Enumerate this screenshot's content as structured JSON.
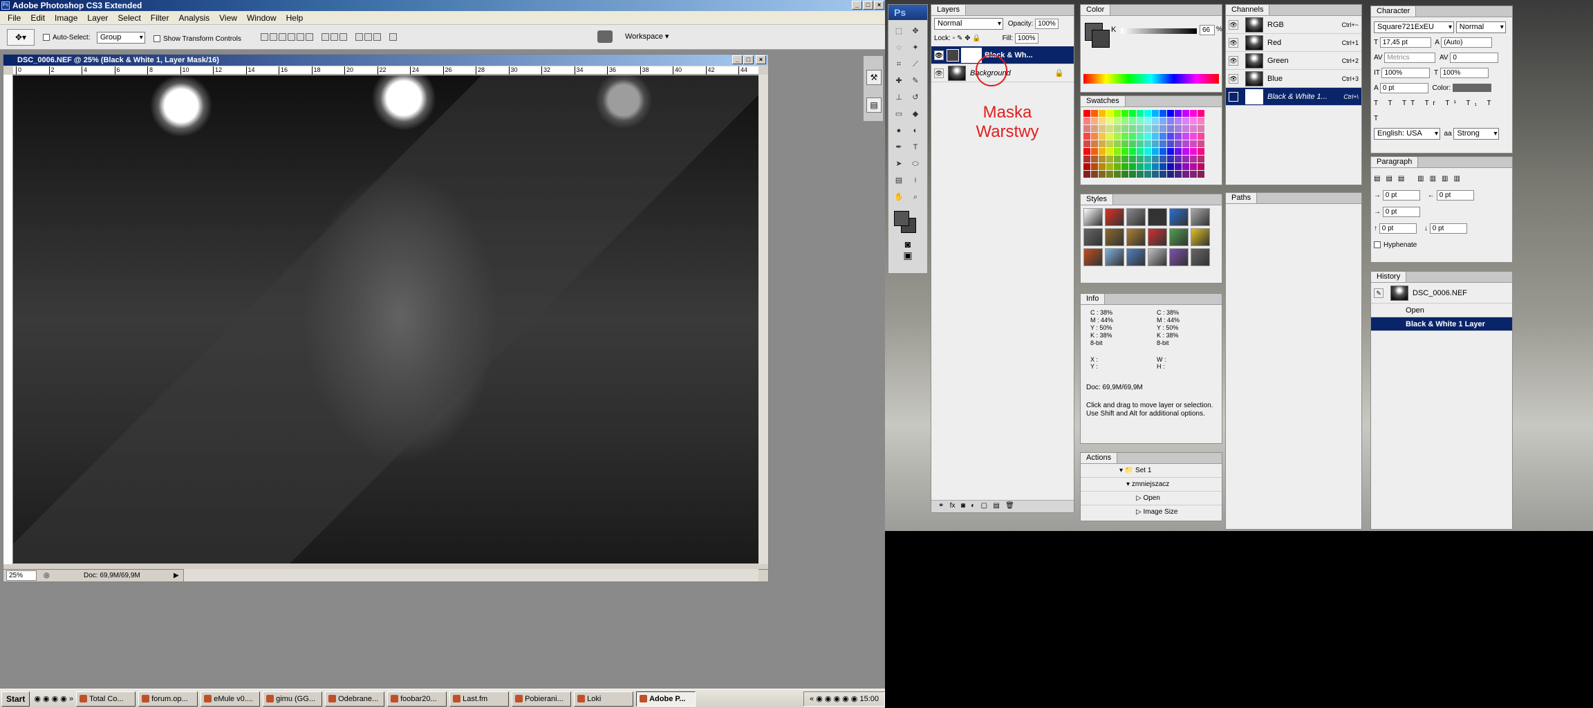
{
  "app": {
    "title": "Adobe Photoshop CS3 Extended"
  },
  "menu": [
    "File",
    "Edit",
    "Image",
    "Layer",
    "Select",
    "Filter",
    "Analysis",
    "View",
    "Window",
    "Help"
  ],
  "options": {
    "auto_select_label": "Auto-Select:",
    "auto_select_value": "Group",
    "transform_label": "Show Transform Controls",
    "workspace_label": "Workspace ▾"
  },
  "document": {
    "title": "DSC_0006.NEF @ 25% (Black & White 1, Layer Mask/16)",
    "zoom": "25%",
    "doc_size": "Doc: 69,9M/69,9M",
    "ruler_ticks": [
      "0",
      "2",
      "4",
      "6",
      "8",
      "10",
      "12",
      "14",
      "16",
      "18",
      "20",
      "22",
      "24",
      "26",
      "28",
      "30",
      "32",
      "34",
      "36",
      "38",
      "40",
      "42",
      "44"
    ]
  },
  "taskbar": {
    "start": "Start",
    "tasks": [
      "Total Co...",
      "forum.op...",
      "eMule v0....",
      "gimu (GG...",
      "Odebrane...",
      "foobar20...",
      "Last.fm",
      "Pobierani...",
      "Loki",
      "Adobe P..."
    ],
    "clock": "15:00"
  },
  "toolbox": {
    "logo": "Ps"
  },
  "layers": {
    "tab": "Layers",
    "blend": "Normal",
    "opacity_label": "Opacity:",
    "opacity": "100%",
    "lock_label": "Lock:",
    "fill_label": "Fill:",
    "fill": "100%",
    "items": [
      {
        "name": "Black & Wh...",
        "selected": true
      },
      {
        "name": "Background",
        "selected": false
      }
    ],
    "annotation": "Maska\nWarstwy"
  },
  "color": {
    "tab": "Color",
    "channel": "K",
    "value": "66",
    "unit": "%"
  },
  "swatches": {
    "tab": "Swatches"
  },
  "styles": {
    "tab": "Styles"
  },
  "info": {
    "tab": "Info",
    "left": [
      "C :  38%",
      "M :  44%",
      "Y :  50%",
      "K :  38%",
      "8-bit"
    ],
    "right": [
      "C :  38%",
      "M :  44%",
      "Y :  50%",
      "K :  38%",
      "8-bit"
    ],
    "xy": "X :\nY :",
    "wh": "W :\nH :",
    "doc": "Doc: 69,9M/69,9M",
    "hint": "Click and drag to move layer or selection. Use Shift and Alt for additional options."
  },
  "actions": {
    "tab": "Actions",
    "items": [
      "Set 1",
      "zmniejszacz",
      "Open",
      "Image Size"
    ]
  },
  "channels": {
    "tab": "Channels",
    "items": [
      {
        "name": "RGB",
        "key": "Ctrl+~"
      },
      {
        "name": "Red",
        "key": "Ctrl+1"
      },
      {
        "name": "Green",
        "key": "Ctrl+2"
      },
      {
        "name": "Blue",
        "key": "Ctrl+3"
      },
      {
        "name": "Black & White 1...",
        "key": "Ctrl+\\"
      }
    ]
  },
  "paths": {
    "tab": "Paths"
  },
  "character": {
    "tab": "Character",
    "font": "Square721ExEU",
    "style": "Normal",
    "size": "17,45 pt",
    "leading": "(Auto)",
    "kerning": "Metrics",
    "tracking": "0",
    "vscale": "100%",
    "hscale": "100%",
    "baseline": "0 pt",
    "color_label": "Color:",
    "language": "English: USA",
    "aa": "Strong"
  },
  "paragraph": {
    "tab": "Paragraph",
    "values": [
      "0 pt",
      "0 pt",
      "0 pt",
      "0 pt",
      "0 pt"
    ],
    "hyphenate": "Hyphenate"
  },
  "history": {
    "tab": "History",
    "snapshot": "DSC_0006.NEF",
    "items": [
      "Open",
      "Black & White 1 Layer"
    ]
  },
  "colors": {
    "accent": "#0a246a",
    "annotation": "#e02020",
    "selection": "#0a246a"
  }
}
